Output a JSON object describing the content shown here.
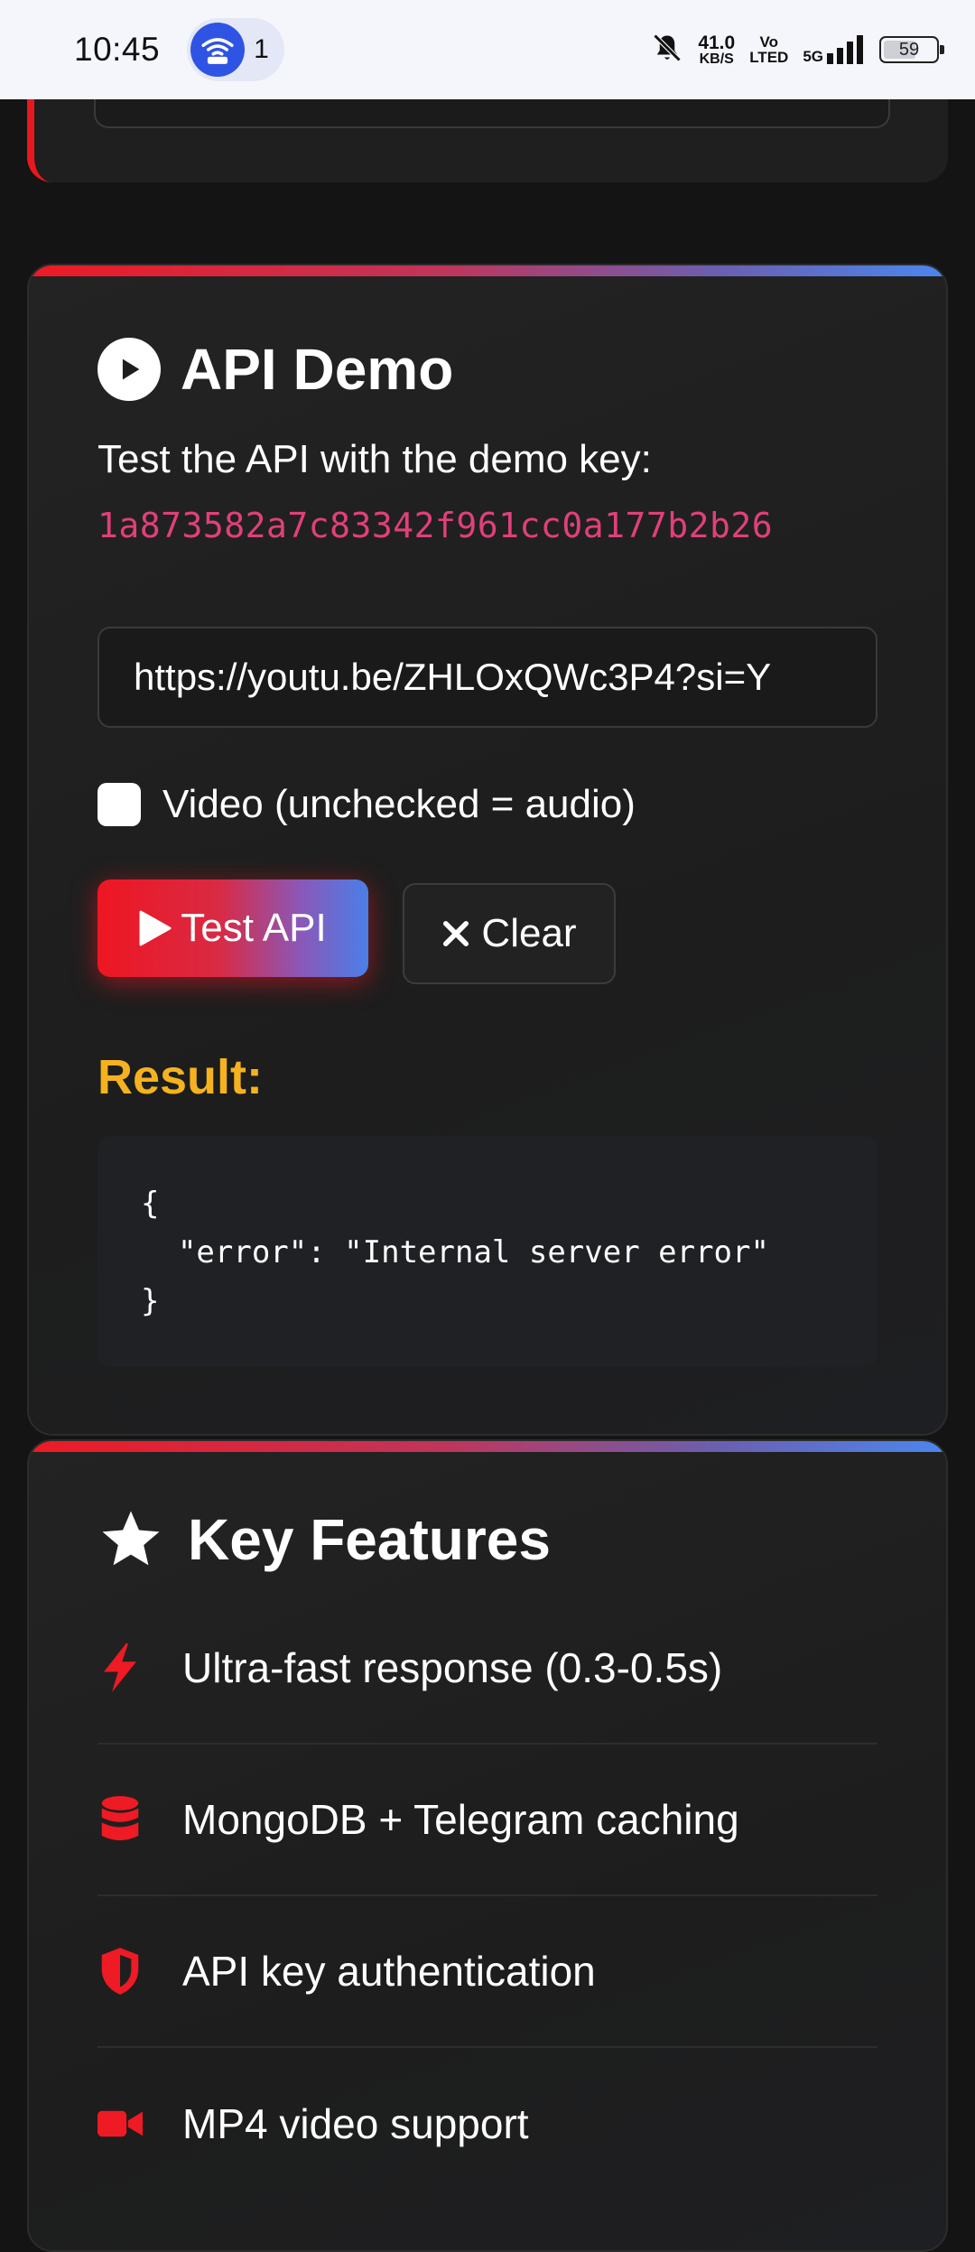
{
  "status_bar": {
    "time": "10:45",
    "hotspot_count": "1",
    "net_speed_value": "41.0",
    "net_speed_unit": "KB/S",
    "volte_top": "Vo",
    "volte_bottom": "LTED",
    "network": "5G",
    "battery": "59"
  },
  "demo": {
    "title": "API Demo",
    "description": "Test the API with the demo key:",
    "demo_key": "1a873582a7c83342f961cc0a177b2b26",
    "url_value": "https://youtu.be/ZHLOxQWc3P4?si=Y",
    "checkbox_label": "Video (unchecked = audio)",
    "checkbox_checked": false,
    "test_button_label": "Test API",
    "clear_button_label": "Clear",
    "result_title": "Result:",
    "result_text": "{\n  \"error\": \"Internal server error\"\n}"
  },
  "features": {
    "title": "Key Features",
    "items": [
      {
        "icon": "bolt-icon",
        "label": "Ultra-fast response (0.3-0.5s)"
      },
      {
        "icon": "database-icon",
        "label": "MongoDB + Telegram caching"
      },
      {
        "icon": "shield-icon",
        "label": "API key authentication"
      },
      {
        "icon": "video-camera-icon",
        "label": "MP4 video support"
      }
    ]
  },
  "colors": {
    "accent_red": "#ee1a24",
    "accent_blue": "#4b86ee",
    "key_pink": "#e0407a",
    "result_yellow": "#f4b21e",
    "background": "#141414"
  }
}
